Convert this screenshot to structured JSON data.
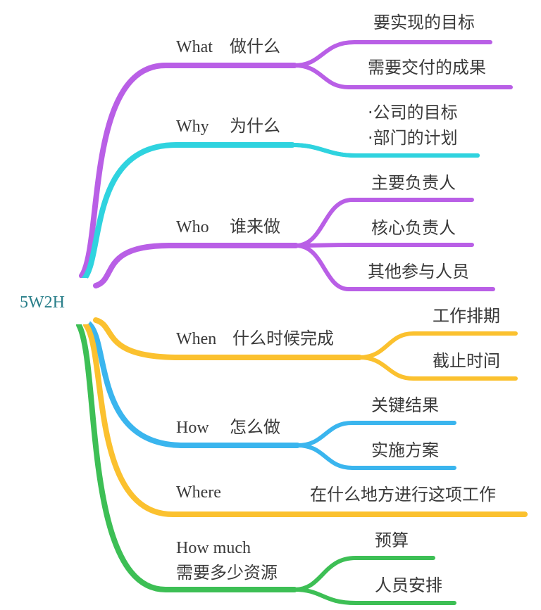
{
  "root": {
    "label": "5W2H"
  },
  "colors": {
    "purple": "#b95fe6",
    "cyan": "#2fd3df",
    "yellow": "#fbc12f",
    "blue": "#3ab5ee",
    "green": "#3dbf55"
  },
  "branches": [
    {
      "key": "what",
      "color": "purple",
      "label_en": "What",
      "label_cn": "做什么",
      "children": [
        "要实现的目标",
        "需要交付的成果"
      ]
    },
    {
      "key": "why",
      "color": "cyan",
      "label_en": "Why",
      "label_cn": "为什么",
      "children": [
        "·公司的目标",
        "·部门的计划"
      ]
    },
    {
      "key": "who",
      "color": "purple",
      "label_en": "Who",
      "label_cn": "谁来做",
      "children": [
        "主要负责人",
        "核心负责人",
        "其他参与人员"
      ]
    },
    {
      "key": "when",
      "color": "yellow",
      "label_en": "When",
      "label_cn": "什么时候完成",
      "children": [
        "工作排期",
        "截止时间"
      ]
    },
    {
      "key": "how",
      "color": "blue",
      "label_en": "How",
      "label_cn": "怎么做",
      "children": [
        "关键结果",
        "实施方案"
      ]
    },
    {
      "key": "where",
      "color": "yellow",
      "label_en": "Where",
      "label_cn": "",
      "children": [
        "在什么地方进行这项工作"
      ]
    },
    {
      "key": "howmuch",
      "color": "green",
      "label_en": "How much",
      "label_cn": "需要多少资源",
      "children": [
        "预算",
        "人员安排"
      ]
    }
  ]
}
